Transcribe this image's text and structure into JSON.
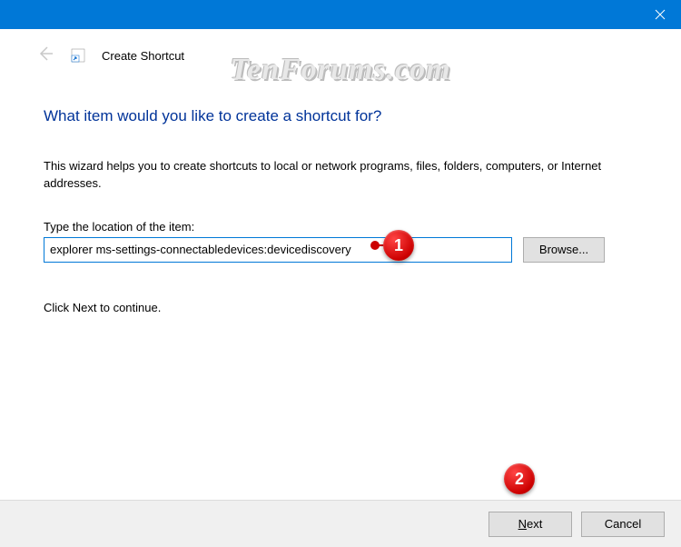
{
  "titlebar": {
    "close_tooltip": "Close"
  },
  "header": {
    "title": "Create Shortcut"
  },
  "watermark": "TenForums.com",
  "main": {
    "heading": "What item would you like to create a shortcut for?",
    "description": "This wizard helps you to create shortcuts to local or network programs, files, folders, computers, or Internet addresses.",
    "input_label": "Type the location of the item:",
    "input_value": "explorer ms-settings-connectabledevices:devicediscovery",
    "browse_label": "Browse...",
    "continue_text": "Click Next to continue."
  },
  "footer": {
    "next_prefix": "N",
    "next_rest": "ext",
    "cancel_label": "Cancel"
  },
  "annotations": {
    "one": "1",
    "two": "2"
  }
}
